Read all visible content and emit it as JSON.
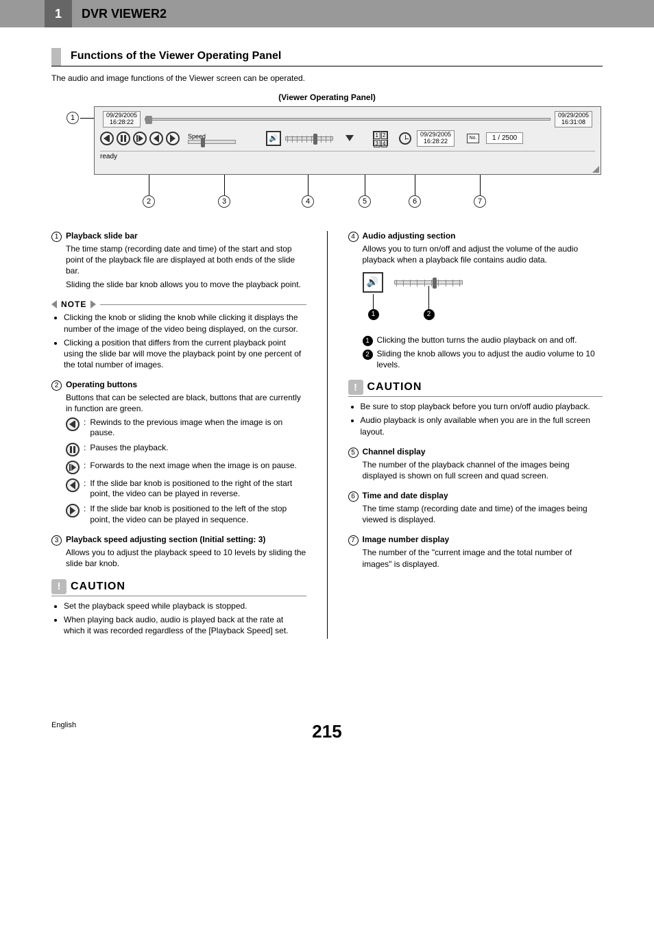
{
  "chapter": {
    "num": "1",
    "title": "DVR VIEWER2"
  },
  "section": {
    "title": "Functions of the Viewer Operating Panel"
  },
  "intro": "The audio and image functions of the Viewer screen can be operated.",
  "panel_title": "(Viewer Operating Panel)",
  "panel": {
    "ts_start": {
      "date": "09/29/2005",
      "time": "16:28:22"
    },
    "ts_end": {
      "date": "09/29/2005",
      "time": "16:31:08"
    },
    "speed_label": "Speed",
    "quad": [
      "1",
      "2",
      "3",
      "4"
    ],
    "datetime": {
      "date": "09/29/2005",
      "time": "16:28:22"
    },
    "no_label": "No.",
    "img_num": "1 / 2500",
    "status": "ready"
  },
  "callouts": [
    "1",
    "2",
    "3",
    "4",
    "5",
    "6",
    "7"
  ],
  "items_left": {
    "i1": {
      "num": "1",
      "title": "Playback slide bar",
      "p1": "The time stamp (recording date and time) of the start and stop point of the playback file are displayed at both ends of the slide bar.",
      "p2": "Sliding the slide bar knob allows you to move the playback point."
    },
    "note_label": "NOTE",
    "note_items": [
      "Clicking the knob or sliding the knob while clicking it displays the number of the image of the video being displayed, on the cursor.",
      "Clicking a position that differs from the current playback point using the slide bar will move the playback point by one percent of the total number of images."
    ],
    "i2": {
      "num": "2",
      "title": "Operating buttons",
      "p1": "Buttons that can be selected are black, buttons that are currently in function are green.",
      "btns": {
        "rew": "Rewinds to the previous image when the image is on pause.",
        "pause": "Pauses the playback.",
        "fwd": "Forwards to the next image when the image is on pause.",
        "rev": "If the slide bar knob is positioned to the right of the start point, the video can be played in reverse.",
        "play": "If the slide bar knob is positioned to the left of the stop point, the video can be played in sequence."
      }
    },
    "i3": {
      "num": "3",
      "title": "Playback speed adjusting section (Initial setting: 3)",
      "p1": "Allows you to adjust the playback speed to 10 levels by sliding the slide bar knob."
    },
    "caution_label": "CAUTION",
    "caution_items_left": [
      "Set the playback speed while playback is stopped.",
      "When playing back audio, audio is played back at the rate at which it was recorded regardless of the [Playback Speed] set."
    ]
  },
  "items_right": {
    "i4": {
      "num": "4",
      "title": "Audio adjusting section",
      "p1": "Allows you to turn on/off and adjust the volume of the audio playback when a playback file contains audio data.",
      "sub1": "Clicking the button turns the audio playback on and off.",
      "sub2": "Sliding the knob allows you to adjust the audio volume to 10 levels."
    },
    "caution_label": "CAUTION",
    "caution_items_right": [
      "Be sure to stop playback before you turn on/off audio playback.",
      "Audio playback is only available when you are in the full screen layout."
    ],
    "i5": {
      "num": "5",
      "title": "Channel display",
      "p1": "The number of the playback channel of the images being displayed is shown on full screen and quad screen."
    },
    "i6": {
      "num": "6",
      "title": "Time and date display",
      "p1": "The time stamp (recording date and time) of the images being viewed is displayed."
    },
    "i7": {
      "num": "7",
      "title": "Image number display",
      "p1": "The number of the \"current image and the total number of images\" is displayed."
    }
  },
  "footer": {
    "lang": "English",
    "page": "215"
  }
}
